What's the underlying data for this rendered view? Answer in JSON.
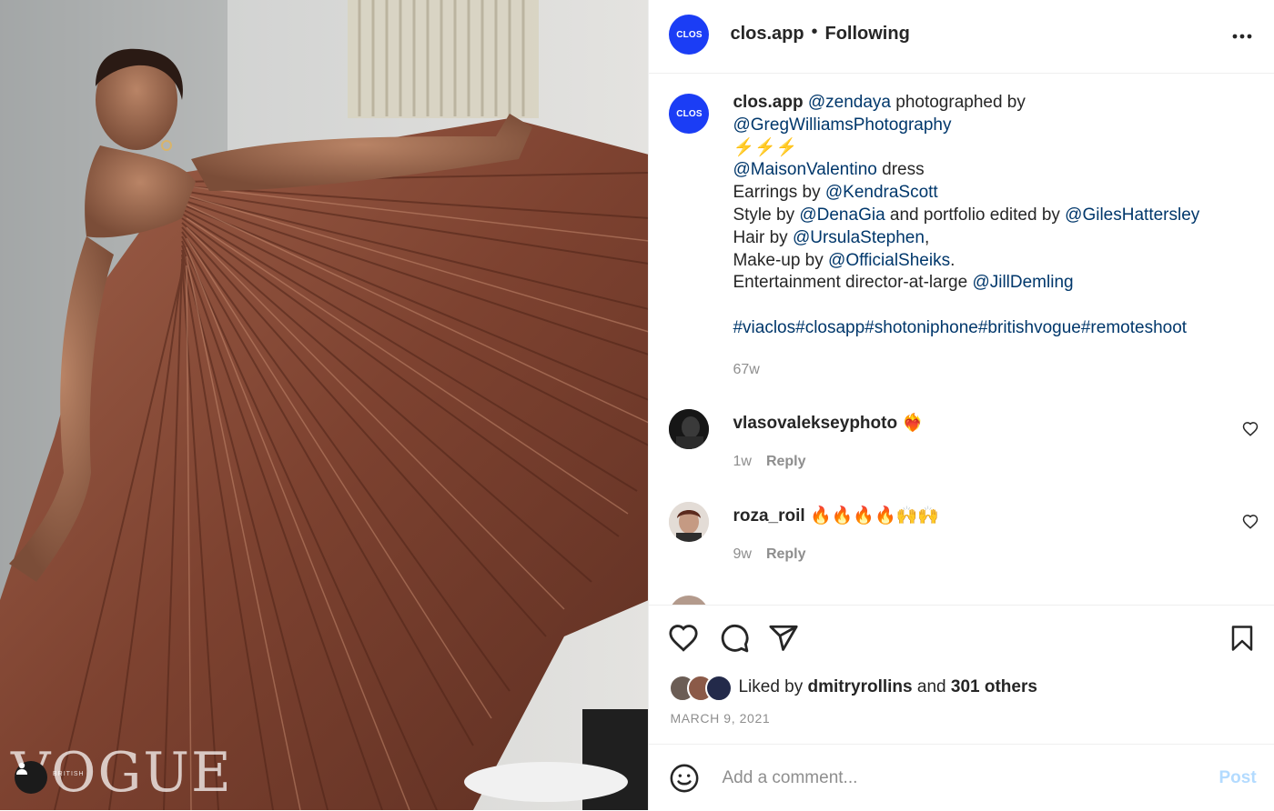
{
  "media": {
    "watermark": "VOGUE",
    "watermark_sub": "BRITISH",
    "user_tag_icon": "person-icon"
  },
  "header": {
    "avatar_text": "CLOS",
    "username": "clos.app",
    "separator": "•",
    "follow_status": "Following",
    "more_icon": "more-horizontal-icon"
  },
  "caption": {
    "avatar_text": "CLOS",
    "username": "clos.app",
    "segments": {
      "l1_mention": "@zendaya",
      "l1_text": " photographed by",
      "l2_mention": "@GregWilliamsPhotography",
      "l3_emoji": "⚡⚡⚡",
      "l4_mention": "@MaisonValentino",
      "l4_text": " dress",
      "l5_text": "Earrings by ",
      "l5_mention": "@KendraScott",
      "l6_text": "Style by ",
      "l6_mention": "@DenaGia",
      "l6_text2": " and portfolio edited by ",
      "l6_mention2": "@GilesHattersley",
      "l7_text": "Hair by ",
      "l7_mention": "@UrsulaStephen",
      "l7_text2": ",",
      "l8_text": "Make-up by ",
      "l8_mention": "@OfficialSheiks",
      "l8_text2": ".",
      "l9_text": "Entertainment director-at-large ",
      "l9_mention": "@JillDemling",
      "hashtags": "#viaclos#closapp#shotoniphone#britishvogue#remoteshoot"
    },
    "time": "67w"
  },
  "comments": [
    {
      "username": "vlasovalekseyphoto",
      "text": " ❤️‍🔥",
      "time": "1w",
      "reply": "Reply"
    },
    {
      "username": "roza_roil",
      "text": " 🔥🔥🔥🔥🙌🙌",
      "time": "9w",
      "reply": "Reply"
    }
  ],
  "actions": {
    "like_icon": "heart-icon",
    "comment_icon": "comment-icon",
    "share_icon": "share-icon",
    "save_icon": "bookmark-icon"
  },
  "likes": {
    "prefix": "Liked by ",
    "user": "dmitryrollins",
    "middle": " and ",
    "others": "301 others"
  },
  "date": "MARCH 9, 2021",
  "composer": {
    "emoji_icon": "emoji-icon",
    "placeholder": "Add a comment...",
    "post_label": "Post"
  },
  "colors": {
    "brand": "#1b3df5",
    "mention": "#00376b",
    "muted": "#8e8e8e",
    "post_disabled": "#b3dbff",
    "dress": "#8a4a35"
  }
}
